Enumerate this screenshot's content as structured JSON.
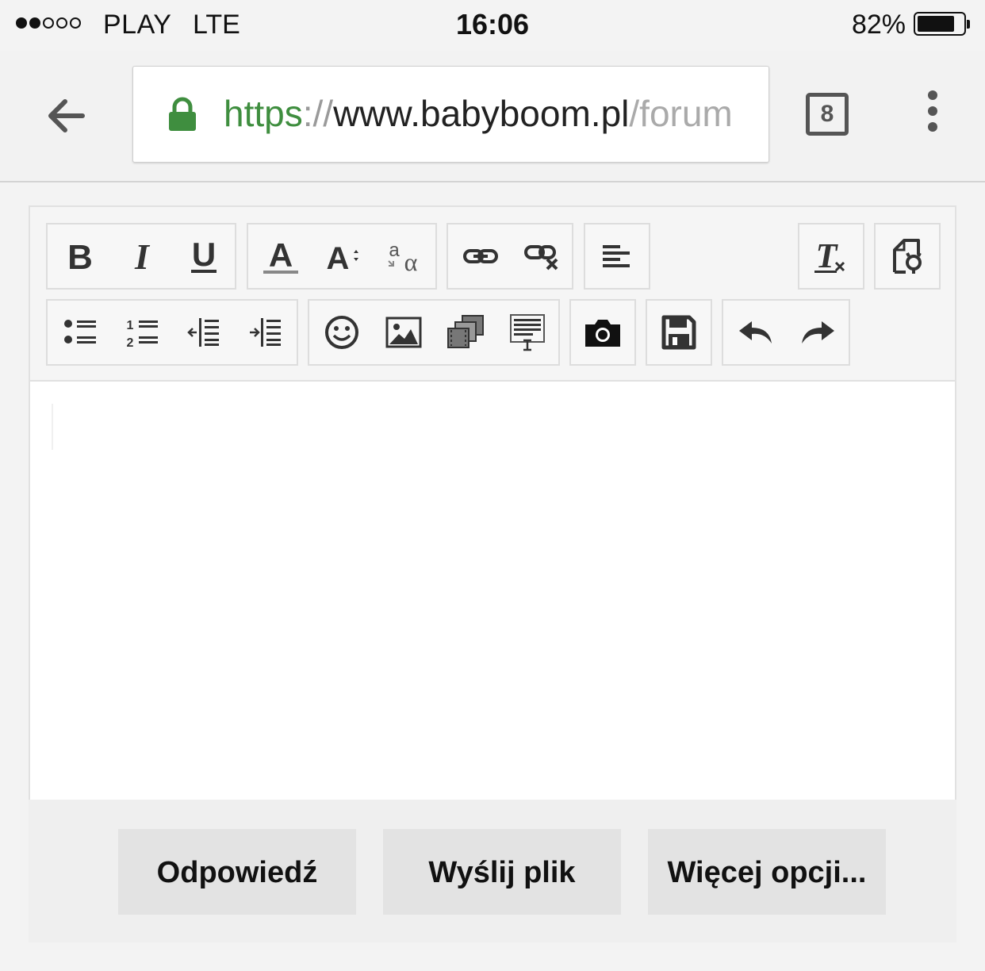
{
  "status_bar": {
    "carrier": "PLAY",
    "network": "LTE",
    "time": "16:06",
    "battery_percent": "82%",
    "signal_bars_filled": 2,
    "signal_bars_total": 5
  },
  "browser": {
    "url_scheme": "https",
    "url_separator": "://",
    "url_host": "www.babyboom.pl",
    "url_path": "/forum",
    "tab_count": "8",
    "secure_color": "#3f8e3f"
  },
  "editor": {
    "toolbar_row1": [
      [
        "bold-icon",
        "italic-icon",
        "underline-icon"
      ],
      [
        "text-color-icon",
        "font-size-icon",
        "font-style-icon"
      ],
      [
        "link-icon",
        "unlink-icon"
      ],
      [
        "align-left-icon"
      ],
      [
        "remove-format-icon"
      ],
      [
        "source-icon"
      ]
    ],
    "toolbar_row2": [
      [
        "bullet-list-icon",
        "numbered-list-icon",
        "outdent-icon",
        "indent-icon"
      ],
      [
        "emoji-icon",
        "image-icon",
        "gallery-icon",
        "template-icon"
      ],
      [
        "camera-icon"
      ],
      [
        "save-icon"
      ],
      [
        "undo-icon",
        "redo-icon"
      ]
    ],
    "content": ""
  },
  "actions": {
    "reply_label": "Odpowiedź",
    "upload_label": "Wyślij plik",
    "more_label": "Więcej opcji..."
  }
}
